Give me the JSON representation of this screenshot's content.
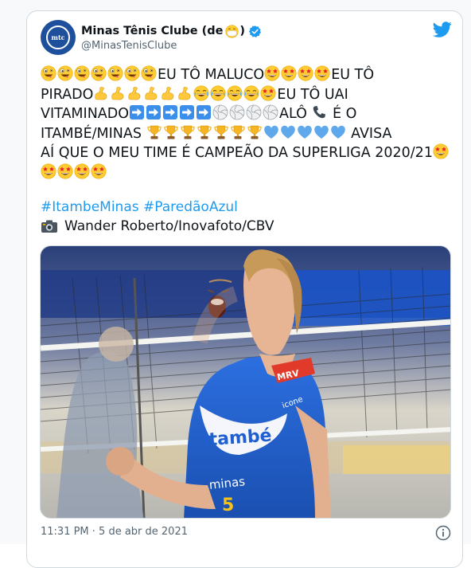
{
  "tweet": {
    "author": {
      "display_name": "Minas Tênis Clube (de",
      "display_name_suffix": ")",
      "handle": "@MinasTenisClube",
      "avatar_text": "mtc",
      "verified": true
    },
    "text": {
      "s1": "EU TÔ MALUCO",
      "s2": "EU TÔ",
      "s3": "PIRADO",
      "s4": "EU TÔ UAI",
      "s5": "VITAMINADO",
      "s6": "ALÔ",
      "s7": "É O",
      "s8": "ITAMBÉ/MINAS",
      "s9": "AVISA",
      "s10": "AÍ QUE O MEU TIME É CAMPEÃO DA SUPERLIGA 2020/21"
    },
    "hashtags": "#ItambeMinas #ParedãoAzul",
    "photo_credit": "Wander Roberto/Inovafoto/CBV",
    "media": {
      "jersey_sponsor": "itambé",
      "jersey_team": "minas",
      "jersey_logo": "MRV",
      "jersey_number": "5",
      "jersey_shoulder": "icone"
    },
    "timestamp": "11:31 PM · 5 de abr de 2021"
  },
  "icons": [
    "twitter-bird-icon",
    "verified-badge-icon",
    "mask-face-emoji-icon",
    "zany-face-emoji-icon",
    "star-struck-emoji-icon",
    "flexed-biceps-emoji-icon",
    "joy-emoji-icon",
    "right-arrow-emoji-icon",
    "volleyball-emoji-icon",
    "telephone-emoji-icon",
    "trophy-emoji-icon",
    "blue-heart-emoji-icon",
    "camera-icon",
    "info-icon"
  ],
  "colors": {
    "accent": "#1d9bf0",
    "text": "#0f1419",
    "muted": "#536471",
    "avatar_bg": "#1d4f9c",
    "jersey_blue": "#1f5fd0"
  }
}
